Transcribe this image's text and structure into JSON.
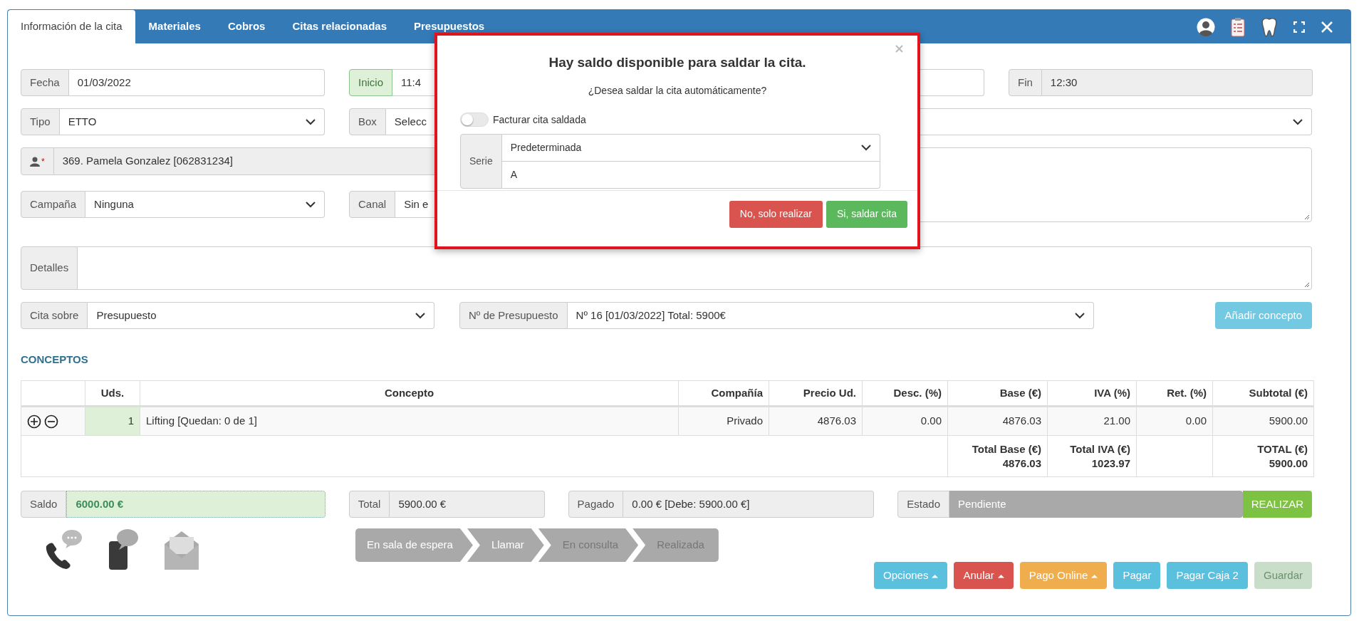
{
  "tabs": [
    {
      "label": "Información de la cita",
      "selected": true
    },
    {
      "label": "Materiales",
      "selected": false
    },
    {
      "label": "Cobros",
      "selected": false
    },
    {
      "label": "Citas relacionadas",
      "selected": false
    },
    {
      "label": "Presupuestos",
      "selected": false
    }
  ],
  "form": {
    "fecha": {
      "label": "Fecha",
      "value": "01/03/2022"
    },
    "inicio": {
      "label": "Inicio",
      "value": "11:4"
    },
    "fin": {
      "label": "Fin",
      "value": "12:30"
    },
    "tipo": {
      "label": "Tipo",
      "value": "ETTO"
    },
    "box": {
      "label": "Box",
      "value": "Selecc"
    },
    "paciente": {
      "value": "369. Pamela Gonzalez [062831234]",
      "required_mark": "*"
    },
    "campana": {
      "label": "Campaña",
      "value": "Ninguna"
    },
    "canal": {
      "label": "Canal",
      "value": "Sin e"
    },
    "detalles": {
      "label": "Detalles"
    },
    "cita_sobre": {
      "label": "Cita sobre",
      "value": "Presupuesto"
    },
    "presupuesto": {
      "label": "Nº de Presupuesto",
      "value": "Nº 16 [01/03/2022] Total: 5900€"
    },
    "add_button": "Añadir concepto"
  },
  "section_title": "CONCEPTOS",
  "table": {
    "columns": [
      "Uds.",
      "Concepto",
      "Compañía",
      "Precio Ud.",
      "Desc. (%)",
      "Base (€)",
      "IVA (%)",
      "Ret. (%)",
      "Subtotal (€)"
    ],
    "rows": [
      {
        "cells": [
          "1",
          "Lifting [Quedan: 0 de 1]",
          "Privado",
          "4876.03",
          "0.00",
          "4876.03",
          "21.00",
          "0.00",
          "5900.00"
        ]
      }
    ],
    "totals": {
      "base": {
        "label": "Total Base (€)",
        "value": "4876.03"
      },
      "iva": {
        "label": "Total IVA (€)",
        "value": "1023.97"
      },
      "total": {
        "label": "TOTAL (€)",
        "value": "5900.00"
      }
    }
  },
  "summary": {
    "saldo": {
      "label": "Saldo",
      "value": "6000.00 €"
    },
    "total": {
      "label": "Total",
      "value": "5900.00 €"
    },
    "pagado": {
      "label": "Pagado",
      "value": "0.00 € [Debe: 5900.00 €]"
    },
    "estado": {
      "label": "Estado",
      "value": "Pendiente",
      "action": "REALIZAR"
    }
  },
  "steps": [
    {
      "label": "En sala de espera",
      "enabled": true
    },
    {
      "label": "Llamar",
      "enabled": true
    },
    {
      "label": "En consulta",
      "enabled": false
    },
    {
      "label": "Realizada",
      "enabled": false
    }
  ],
  "buttons": [
    {
      "label": "Opciones",
      "color": "#5bc0de",
      "dropdown": true,
      "disabled": false
    },
    {
      "label": "Anular",
      "color": "#d9534f",
      "dropdown": true,
      "disabled": false
    },
    {
      "label": "Pago Online",
      "color": "#f0ad4e",
      "dropdown": true,
      "disabled": false
    },
    {
      "label": "Pagar",
      "color": "#5bc0de",
      "dropdown": false,
      "disabled": false
    },
    {
      "label": "Pagar Caja 2",
      "color": "#5bc0de",
      "dropdown": false,
      "disabled": false
    },
    {
      "label": "Guardar",
      "color": "#c8dec8",
      "dropdown": false,
      "disabled": true
    }
  ],
  "modal": {
    "title": "Hay saldo disponible para saldar la cita.",
    "message": "¿Desea saldar la cita automáticamente?",
    "toggle": {
      "label": "Facturar cita saldada",
      "on": false
    },
    "serie": {
      "label": "Serie",
      "select": "Predeterminada",
      "value": "A"
    },
    "buttons": [
      {
        "label": "No, solo realizar",
        "color": "#d9534f"
      },
      {
        "label": "Si, saldar cita",
        "color": "#5cb85c"
      }
    ]
  }
}
